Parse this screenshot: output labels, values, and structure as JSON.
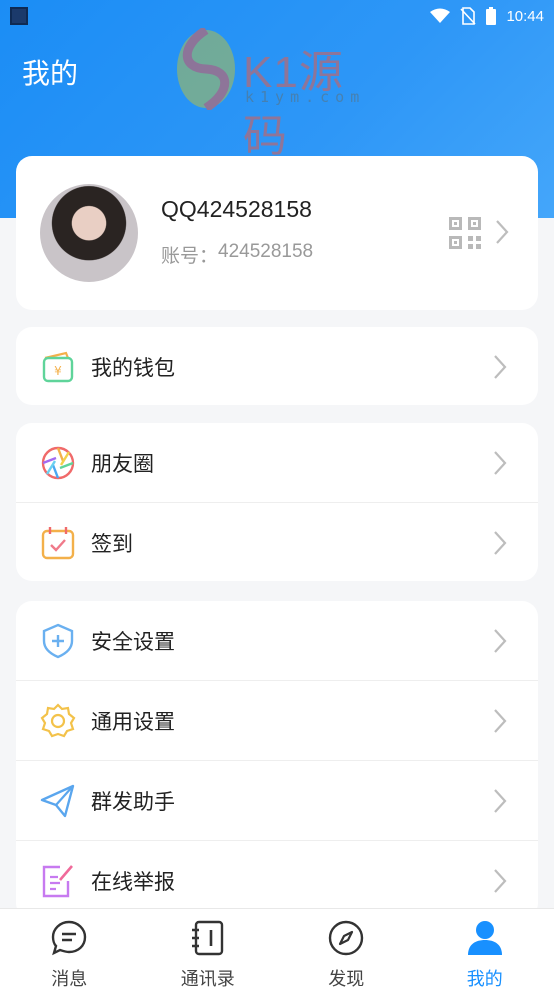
{
  "status_bar": {
    "time": "10:44"
  },
  "header": {
    "title": "我的"
  },
  "watermark": {
    "brand": "K1源码",
    "domain": "k1ym.com"
  },
  "profile": {
    "name": "QQ424528158",
    "account_label": "账号：",
    "account_value": "424528158"
  },
  "groups": [
    {
      "items": [
        {
          "label": "我的钱包",
          "icon": "wallet-icon"
        }
      ]
    },
    {
      "items": [
        {
          "label": "朋友圈",
          "icon": "moments-icon"
        },
        {
          "label": "签到",
          "icon": "calendar-check-icon"
        }
      ]
    },
    {
      "items": [
        {
          "label": "安全设置",
          "icon": "shield-icon"
        },
        {
          "label": "通用设置",
          "icon": "gear-icon"
        },
        {
          "label": "群发助手",
          "icon": "paper-plane-icon"
        },
        {
          "label": "在线举报",
          "icon": "report-edit-icon"
        }
      ]
    }
  ],
  "tabs": [
    {
      "label": "消息",
      "icon": "chat-icon",
      "active": false
    },
    {
      "label": "通讯录",
      "icon": "contacts-icon",
      "active": false
    },
    {
      "label": "发现",
      "icon": "compass-icon",
      "active": false
    },
    {
      "label": "我的",
      "icon": "person-icon",
      "active": true
    }
  ],
  "colors": {
    "primary": "#1890ff",
    "header_gradient_start": "#1b8df5",
    "header_gradient_end": "#44a6fa"
  }
}
